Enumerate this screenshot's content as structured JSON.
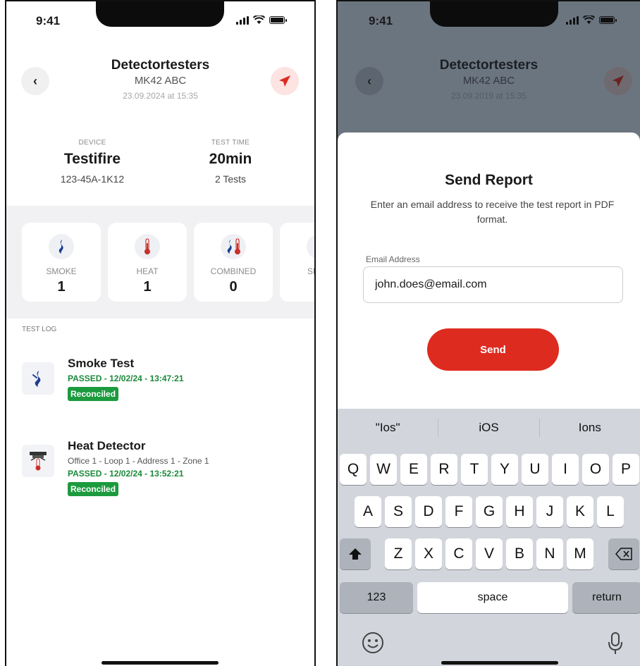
{
  "left": {
    "status_time": "9:41",
    "header": {
      "title": "Detectortesters",
      "plate": "MK42 ABC",
      "date": "23.09.2024 at 15:35"
    },
    "summary": {
      "device_label": "DEVICE",
      "device_value": "Testifire",
      "device_sub": "123-45A-1K12",
      "time_label": "TEST TIME",
      "time_value": "20min",
      "time_sub": "2 Tests"
    },
    "test_types": [
      {
        "label": "SMOKE",
        "count": "1",
        "icon": "smoke-icon"
      },
      {
        "label": "HEAT",
        "count": "1",
        "icon": "thermometer-icon"
      },
      {
        "label": "COMBINED",
        "count": "0",
        "icon": "combined-icon"
      },
      {
        "label": "SEQU",
        "count": "",
        "icon": "thermometer-icon"
      }
    ],
    "log_heading": "TEST LOG",
    "log": [
      {
        "title": "Smoke Test",
        "detail": "",
        "status": "PASSED - 12/02/24 - 13:47:21",
        "badge": "Reconciled",
        "icon": "smoke-icon"
      },
      {
        "title": "Heat Detector",
        "detail": "Office 1  - Loop 1  - Address 1  - Zone 1",
        "status": "PASSED - 12/02/24 - 13:52:21",
        "badge": "Reconciled",
        "icon": "heat-detector-icon"
      }
    ]
  },
  "right": {
    "status_time": "9:41",
    "header": {
      "title": "Detectortesters",
      "plate": "MK42 ABC",
      "date": "23.09.2019 at 15:35"
    },
    "sheet": {
      "title": "Send Report",
      "description": "Enter an email address to receive the test report in PDF format.",
      "field_label": "Email Address",
      "field_value": "john.does@email.com",
      "button_label": "Send"
    },
    "keyboard": {
      "suggestions": [
        "\"Ios\"",
        "iOS",
        "Ions"
      ],
      "row1": [
        "Q",
        "W",
        "E",
        "R",
        "T",
        "Y",
        "U",
        "I",
        "O",
        "P"
      ],
      "row2": [
        "A",
        "S",
        "D",
        "F",
        "G",
        "H",
        "J",
        "K",
        "L"
      ],
      "row3": [
        "Z",
        "X",
        "C",
        "V",
        "B",
        "N",
        "M"
      ],
      "numbers_label": "123",
      "space_label": "space",
      "return_label": "return"
    }
  },
  "colors": {
    "accent_red": "#de2b20",
    "success_green": "#1c9a3e",
    "overlay": "#6b7580"
  }
}
